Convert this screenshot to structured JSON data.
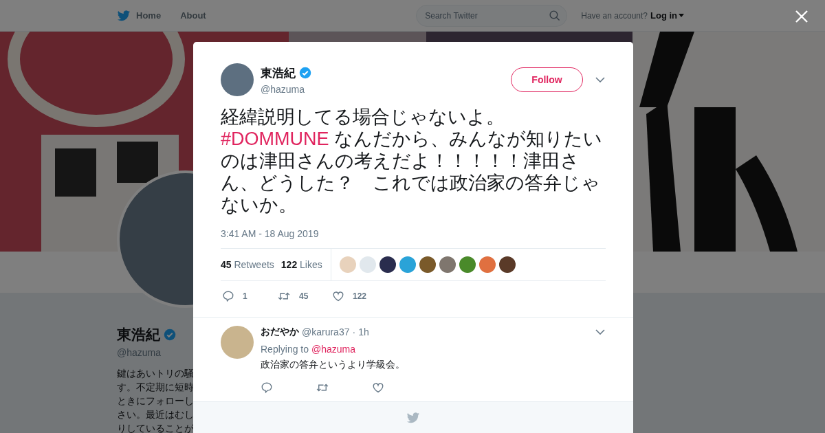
{
  "topbar": {
    "nav": [
      {
        "label": "Home",
        "selected": false
      },
      {
        "label": "About",
        "selected": false
      }
    ],
    "search": {
      "placeholder": "Search Twitter"
    },
    "account_prompt": "Have an account?",
    "login": "Log in"
  },
  "profile": {
    "name": "東浩紀",
    "verified": true,
    "handle": "@hazuma",
    "bio_lines": [
      "鍵はあいトリの騒",
      "す。不定期に短時",
      "ときにフォローし",
      "さい。最近はむし",
      "りしていることが"
    ]
  },
  "tweet": {
    "name": "東浩紀",
    "verified": true,
    "handle": "@hazuma",
    "follow": "Follow",
    "text_before": "経緯説明してる場合じゃないよ。",
    "hashtag": "#DOMMUNE",
    "text_after": " なんだから、みんなが知りたいのは津田さんの考えだよ！！！！！津田さん、どうした？　これでは政治家の答弁じゃないか。",
    "timestamp": "3:41 AM - 18 Aug 2019",
    "stats": [
      {
        "count": "45",
        "label": "Retweets"
      },
      {
        "count": "122",
        "label": "Likes"
      }
    ],
    "actions": [
      {
        "kind": "reply",
        "count": "1"
      },
      {
        "kind": "retweet",
        "count": "45"
      },
      {
        "kind": "like",
        "count": "122"
      }
    ]
  },
  "reply": {
    "name": "おだやか",
    "handle": "@karura37",
    "separator": "·",
    "time": "1h",
    "replying_to": "Replying to",
    "mention": "@hazuma",
    "text": "政治家の答弁というより学級会。",
    "actions": [
      {
        "kind": "reply"
      },
      {
        "kind": "retweet"
      },
      {
        "kind": "like"
      }
    ]
  }
}
